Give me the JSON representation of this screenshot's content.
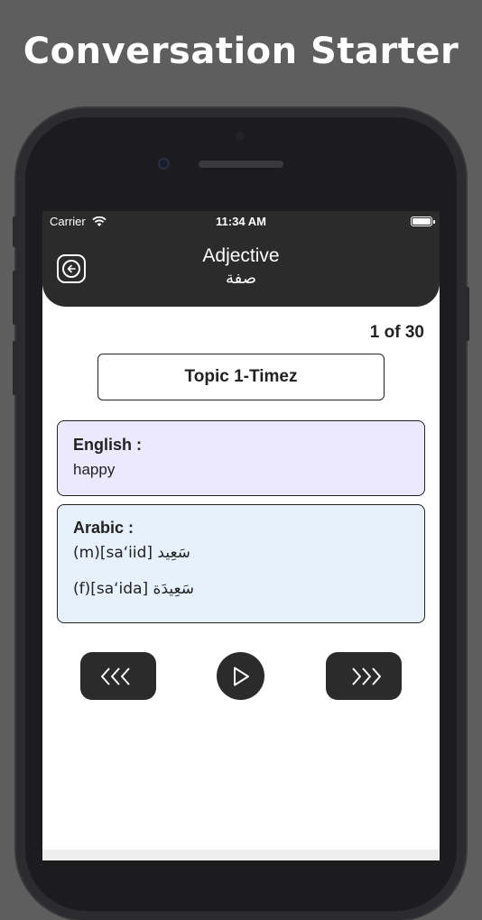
{
  "promo": {
    "title": "Conversation Starter"
  },
  "status_bar": {
    "carrier": "Carrier",
    "time": "11:34 AM"
  },
  "header": {
    "title": "Adjective",
    "subtitle": "صفة"
  },
  "counter": "1 of 30",
  "topic": "Topic 1-Timez",
  "english_card": {
    "label": "English :",
    "text": "happy"
  },
  "arabic_card": {
    "label": "Arabic :",
    "masculine": "(m)[sa‘iid] سَعِيد",
    "feminine": "(f)[sa‘ida] سَعِيدَة"
  },
  "controls": {
    "prev": "prev-icon",
    "play": "play-icon",
    "next": "next-icon"
  },
  "colors": {
    "header": "#2b2b2b",
    "english_bg": "#ece8fd",
    "arabic_bg": "#e6f1fc",
    "background": "#5e5e5e"
  }
}
